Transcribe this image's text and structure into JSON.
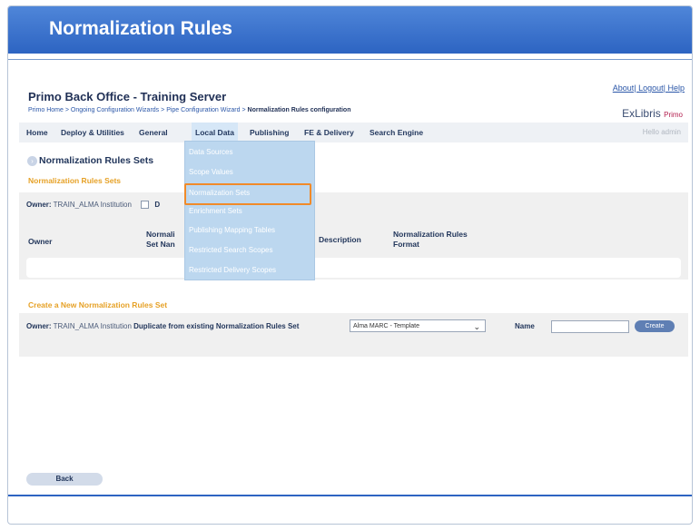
{
  "slide": {
    "title": "Normalization Rules"
  },
  "app": {
    "title": "Primo Back Office - Training Server",
    "top_links": "About| Logout| Help",
    "brand": "ExLibris",
    "brand_product": "Primo",
    "hello": "Hello  admin"
  },
  "breadcrumb": {
    "items": [
      "Primo Home",
      "Ongoing Configuration Wizards",
      "Pipe Configuration Wizard"
    ],
    "separator": ">",
    "current": "Normalization Rules configuration"
  },
  "nav": {
    "items": [
      "Home",
      "Deploy & Utilities",
      "General",
      "Local Data",
      "Publishing",
      "FE & Delivery",
      "Search Engine"
    ],
    "active": "Local Data"
  },
  "dropdown": {
    "items": [
      "Data Sources",
      "Scope Values",
      "Normalization Sets",
      "Enrichment Sets",
      "Publishing Mapping Tables",
      "Restricted Search Scopes",
      "Restricted Delivery Scopes"
    ],
    "highlighted": "Normalization Sets"
  },
  "section": {
    "title": "Normalization Rules Sets",
    "subtitle": "Normalization Rules Sets",
    "owner_label": "Owner:",
    "owner_value": "TRAIN_ALMA Institution",
    "checkbox_label": "D"
  },
  "table": {
    "headers": {
      "owner": "Owner",
      "set_name_line1": "Normali",
      "set_name_line2": "Set Nan",
      "description": "Description",
      "format_line1": "Normalization Rules",
      "format_line2": "Format"
    }
  },
  "create": {
    "title": "Create a New Normalization Rules Set",
    "owner_label": "Owner:",
    "owner_value": "TRAIN_ALMA Institution",
    "duplicate_label": "Duplicate from existing Normalization Rules Set",
    "select_value": "Alma MARC - Template",
    "name_label": "Name",
    "name_value": "",
    "create_button": "Create"
  },
  "back_button": "Back"
}
